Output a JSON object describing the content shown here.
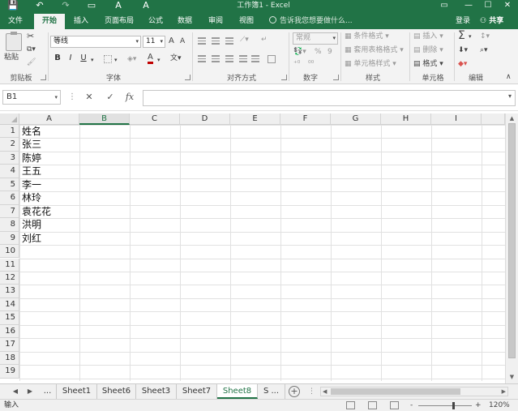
{
  "window": {
    "title": "工作簿1 - Excel",
    "quick_access": [
      "save-icon",
      "undo-icon",
      "redo-icon",
      "touch-mode-icon"
    ],
    "qa_glyphs": {
      "save": "💾",
      "undo": "↶",
      "redo": "↷",
      "customize": "A",
      "font_a": "A"
    },
    "controls": {
      "minimize": "—",
      "restore": "☐",
      "close": "✕"
    },
    "accent": "#217346"
  },
  "tabs": [
    {
      "label": "文件"
    },
    {
      "label": "开始"
    },
    {
      "label": "插入"
    },
    {
      "label": "页面布局"
    },
    {
      "label": "公式"
    },
    {
      "label": "数据"
    },
    {
      "label": "审阅"
    },
    {
      "label": "视图"
    }
  ],
  "active_tab": "开始",
  "tell_me": "告诉我您想要做什么...",
  "sign_in": "登录",
  "share": "共享",
  "ribbon": {
    "clipboard": {
      "label": "剪贴板",
      "paste": "粘贴"
    },
    "font": {
      "label": "字体",
      "font_name": "等线",
      "font_size": "11",
      "grow": "A",
      "shrink": "A",
      "bold": "B",
      "italic": "I",
      "underline": "U",
      "font_color_letter": "A"
    },
    "alignment": {
      "label": "对齐方式"
    },
    "number": {
      "label": "数字",
      "format": "常规",
      "percent": "%",
      "comma": "9"
    },
    "styles": {
      "label": "样式",
      "conditional": "条件格式",
      "as_table": "套用表格格式",
      "cell_styles": "单元格样式"
    },
    "cells": {
      "label": "单元格",
      "insert": "插入",
      "delete": "删除",
      "format": "格式"
    },
    "editing": {
      "label": "编辑",
      "sigma": "Σ"
    }
  },
  "formula_bar": {
    "name_box": "B1",
    "fx": "fx",
    "cancel": "✕",
    "enter": "✓",
    "dots": "⋮",
    "value": ""
  },
  "sheet": {
    "columns": [
      "A",
      "B",
      "C",
      "D",
      "E",
      "F",
      "G",
      "H",
      "I"
    ],
    "selected_column": "B",
    "rows": [
      "1",
      "2",
      "3",
      "4",
      "5",
      "6",
      "7",
      "8",
      "9",
      "10",
      "11",
      "12",
      "13",
      "14",
      "15",
      "16",
      "17",
      "18",
      "19"
    ],
    "column_a": [
      "姓名",
      "张三",
      "陈婷",
      "王五",
      "李一",
      "林玲",
      "袁花花",
      "洪明",
      "刘红"
    ]
  },
  "sheet_tabs": {
    "items": [
      "Sheet1",
      "Sheet6",
      "Sheet3",
      "Sheet7",
      "Sheet8",
      "S ..."
    ],
    "active": "Sheet8",
    "ellipsis": "...",
    "add": "+"
  },
  "status": {
    "mode": "输入",
    "zoom": "120%",
    "zoom_minus": "-",
    "zoom_plus": "+"
  }
}
